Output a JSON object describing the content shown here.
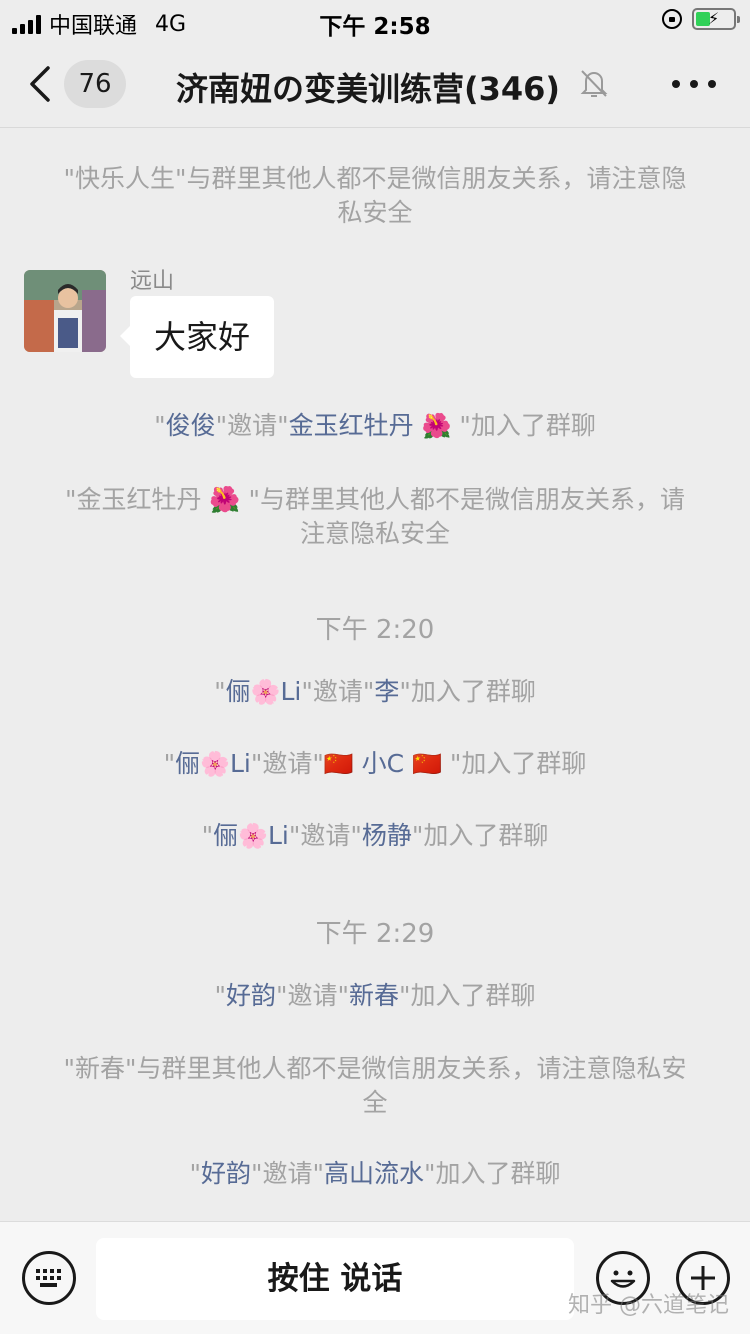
{
  "status_bar": {
    "carrier": "中国联通",
    "network": "4G",
    "time": "下午 2:58"
  },
  "nav": {
    "unread_count": "76",
    "title": "济南妞の变美训练营(346)"
  },
  "messages": {
    "sys1": "\"快乐人生\"与群里其他人都不是微信朋友关系，请注意隐私安全",
    "sender": "远山",
    "bubble_text": "大家好",
    "inv1": {
      "q1": "\"",
      "inviter": "俊俊",
      "mid": "\"邀请\"",
      "invitee": "金玉红牡丹",
      "emoji": "🌺",
      "end": " \"加入了群聊"
    },
    "sys2": "\"金玉红牡丹 🌺 \"与群里其他人都不是微信朋友关系，请注意隐私安全",
    "ts1": "下午 2:20",
    "inv2": {
      "q1": "\"",
      "inviter_a": "俪",
      "emoji": "🌸",
      "inviter_b": "Li",
      "mid": "\"邀请\"",
      "invitee": "李",
      "end": "\"加入了群聊"
    },
    "inv3": {
      "q1": "\"",
      "inviter_a": "俪",
      "emoji": "🌸",
      "inviter_b": "Li",
      "mid": "\"邀请\"",
      "flag1": "🇨🇳",
      "invitee": " 小C ",
      "flag2": "🇨🇳",
      "end": " \"加入了群聊"
    },
    "inv4": {
      "q1": "\"",
      "inviter_a": "俪",
      "emoji": "🌸",
      "inviter_b": "Li",
      "mid": "\"邀请\"",
      "invitee": "杨静",
      "end": "\"加入了群聊"
    },
    "ts2": "下午 2:29",
    "inv5": {
      "q1": "\"",
      "inviter": "好韵",
      "mid": "\"邀请\"",
      "invitee": "新春",
      "end": "\"加入了群聊"
    },
    "sys3": "\"新春\"与群里其他人都不是微信朋友关系，请注意隐私安全",
    "inv6": {
      "q1": "\"",
      "inviter": "好韵",
      "mid": "\"邀请\"",
      "invitee": "高山流水",
      "end": "\"加入了群聊"
    }
  },
  "toolbar": {
    "hold_to_talk": "按住 说话"
  },
  "watermark": "知乎 @六道笔记",
  "colors": {
    "background": "#ededed",
    "link_name": "#576b95",
    "system_text": "#a3a3a3"
  },
  "icons": [
    "back-icon",
    "mute-bell-icon",
    "more-icon",
    "keyboard-icon",
    "emoji-face-icon",
    "plus-icon"
  ]
}
